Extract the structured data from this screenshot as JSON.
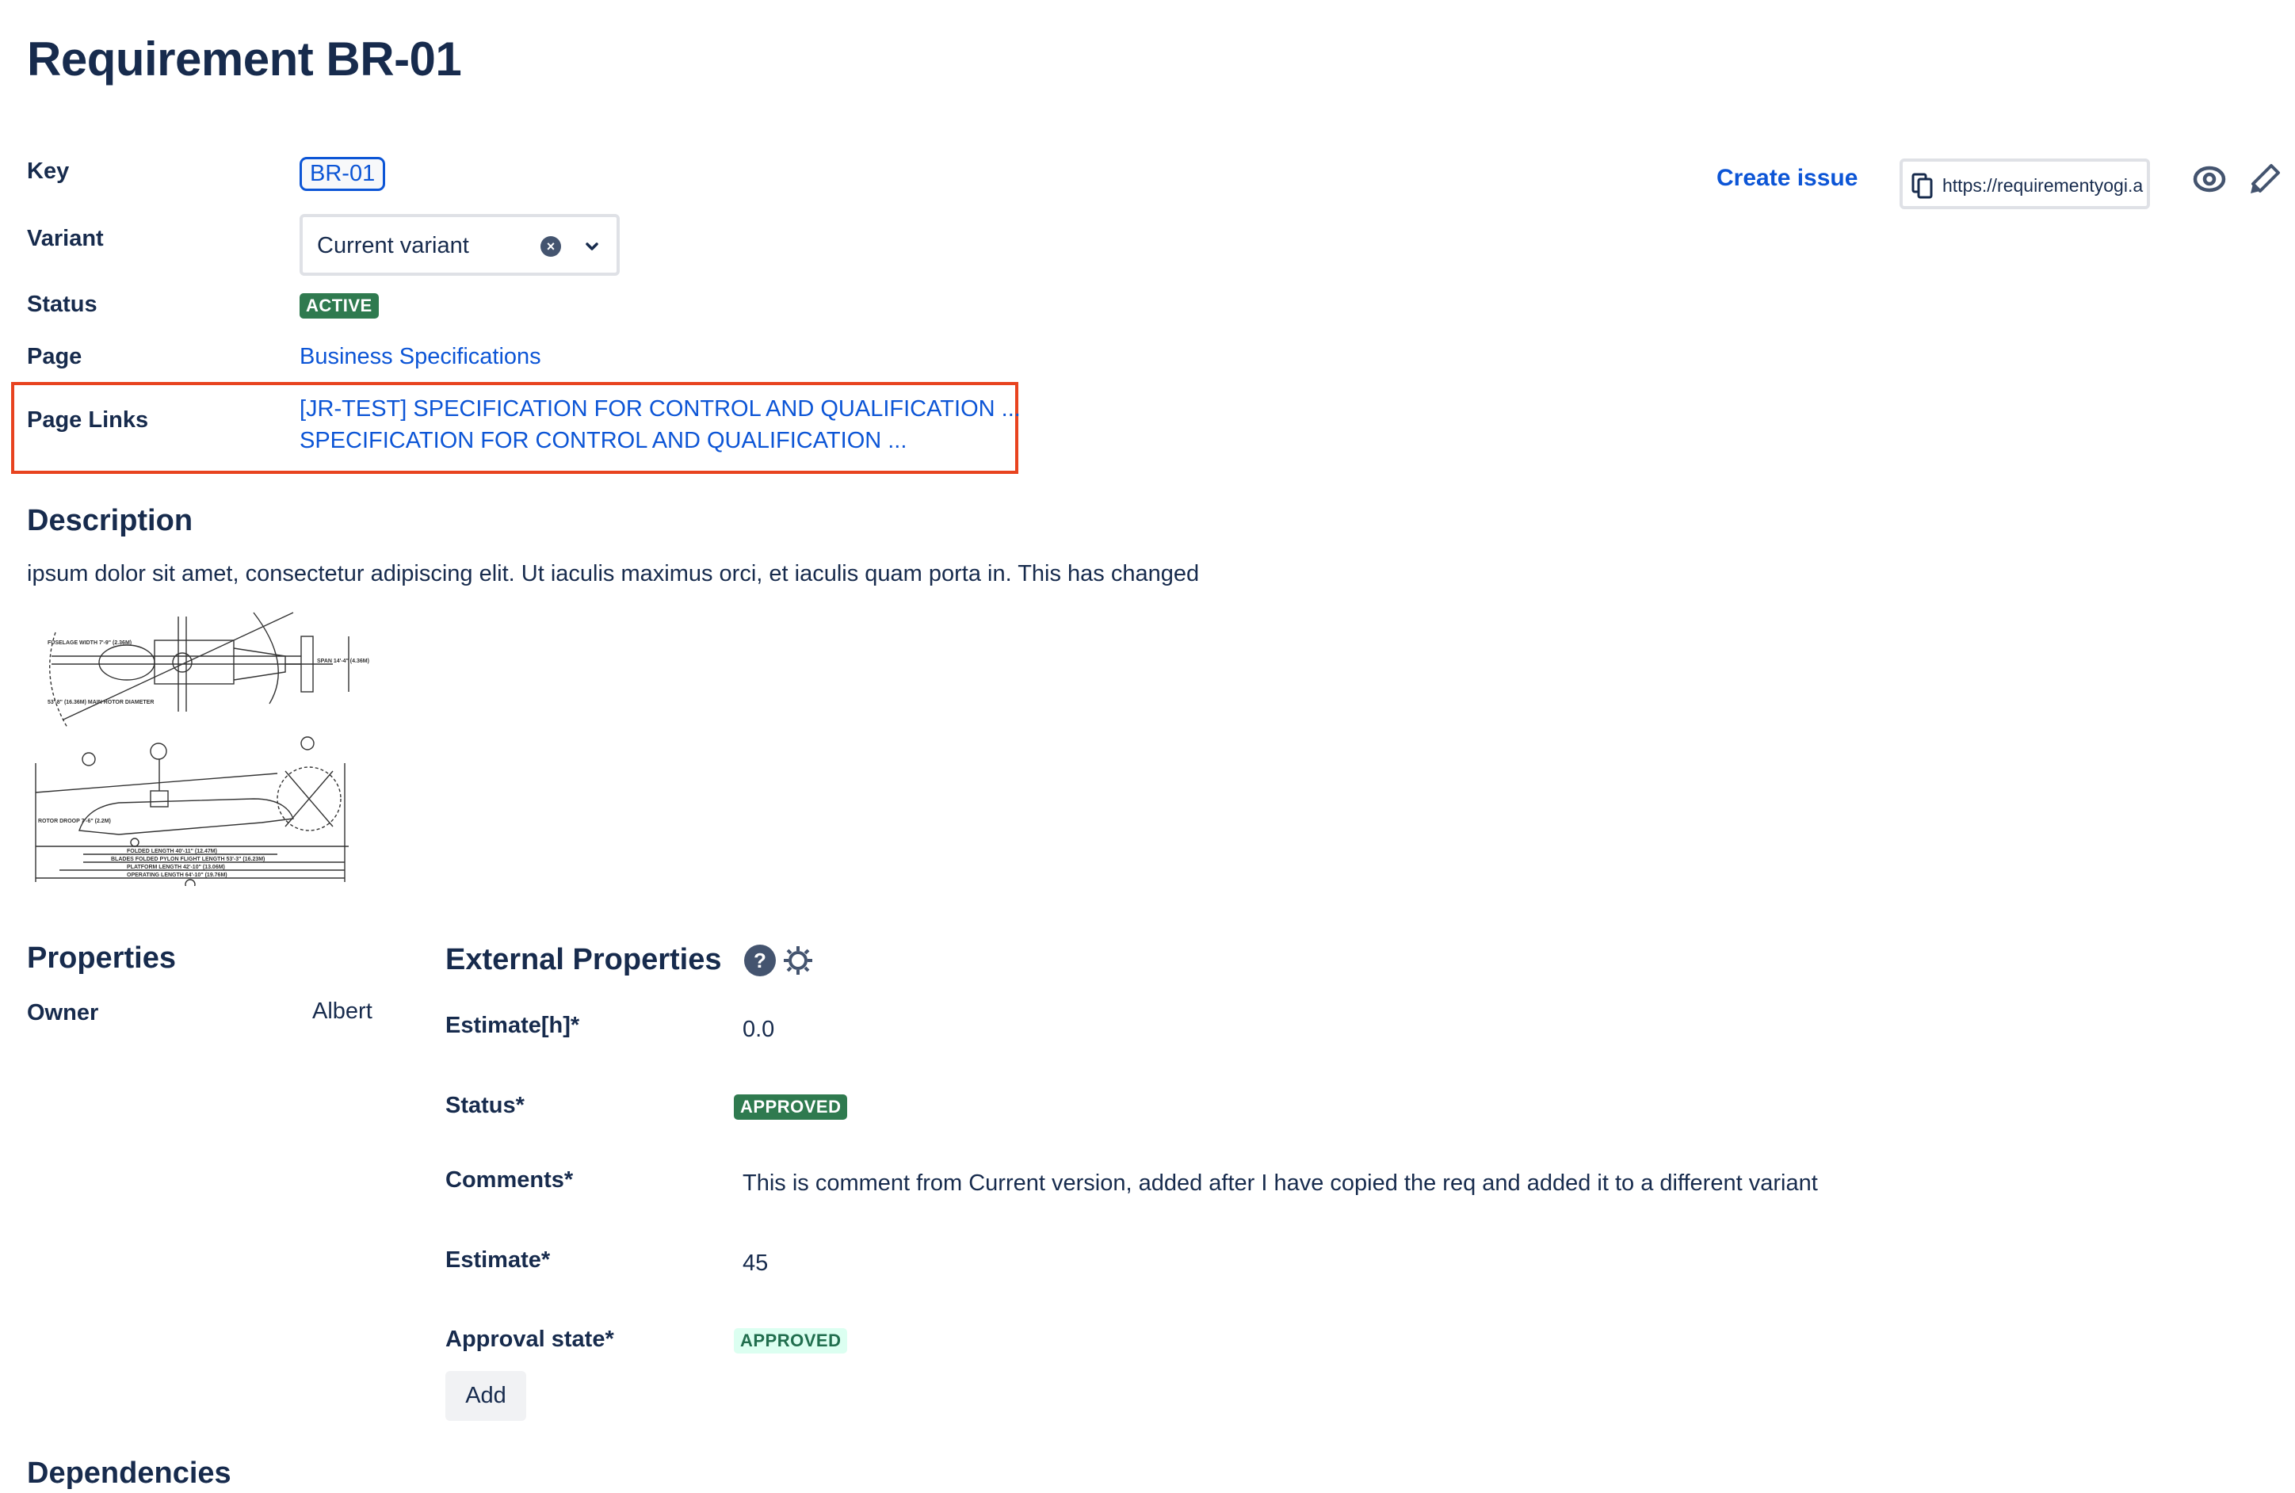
{
  "page": {
    "title": "Requirement BR-01"
  },
  "fields": {
    "key": {
      "label": "Key",
      "value": "BR-01"
    },
    "variant": {
      "label": "Variant",
      "value": "Current variant"
    },
    "status": {
      "label": "Status",
      "value": "ACTIVE",
      "color": "#2f7a4f"
    },
    "page": {
      "label": "Page",
      "value": "Business Specifications"
    },
    "page_links": {
      "label": "Page Links",
      "links": [
        "[JR-TEST] SPECIFICATION FOR CONTROL AND QUALIFICATION ...",
        "SPECIFICATION FOR CONTROL AND QUALIFICATION ..."
      ],
      "highlight_color": "#e8431f"
    }
  },
  "toolbar": {
    "create_issue": "Create issue",
    "url": "https://requirementyogi.a",
    "icons": [
      "copy-icon",
      "eye-icon",
      "pencil-icon"
    ]
  },
  "description": {
    "heading": "Description",
    "text": "ipsum dolor sit amet, consectetur adipiscing elit. Ut iaculis maximus orci, et iaculis quam porta in. This has changed",
    "image_alt": "helicopter technical drawing",
    "image_labels": {
      "top_left": "FUSELAGE WIDTH 7'-9\" (2.36M)",
      "rotor": "53'-8\" (16.36M) MAIN ROTOR DIAMETER",
      "span": "SPAN 14'-4\" (4.36M)",
      "folded": "FOLDED LENGTH 40'-11\" (12.47M)",
      "blades": "BLADES FOLDED PYLON FLIGHT LENGTH 53'-3\" (16.23M)",
      "platform": "PLATFORM LENGTH 42'-10\" (13.06M)",
      "operating": "OPERATING LENGTH 64'-10\" (19.76M)",
      "rotor_droop": "ROTOR DROOP 7'-6\" (2.2M)"
    }
  },
  "properties": {
    "heading": "Properties",
    "items": [
      {
        "label": "Owner",
        "value": "Albert"
      }
    ]
  },
  "external_properties": {
    "heading": "External Properties",
    "items": [
      {
        "label": "Estimate[h]*",
        "value": "0.0",
        "type": "text"
      },
      {
        "label": "Status*",
        "value": "APPROVED",
        "type": "lozenge-bold"
      },
      {
        "label": "Comments*",
        "value": "This is comment from Current version, added after I have copied the req and added it to a different variant",
        "type": "text"
      },
      {
        "label": "Estimate*",
        "value": "45",
        "type": "text"
      },
      {
        "label": "Approval state*",
        "value": "APPROVED",
        "type": "lozenge-subtle"
      }
    ],
    "add_label": "Add"
  },
  "dependencies": {
    "heading": "Dependencies"
  }
}
